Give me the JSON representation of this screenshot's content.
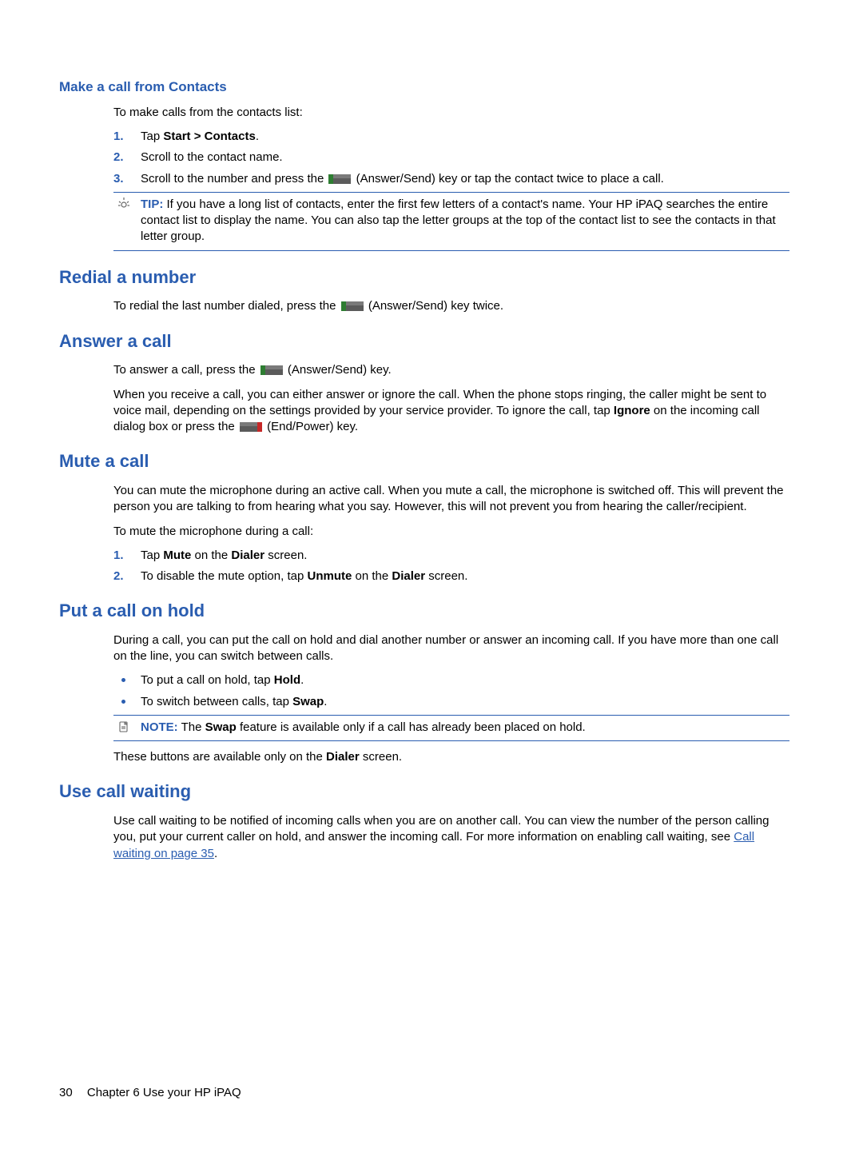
{
  "sec_contacts": {
    "title": "Make a call from Contacts",
    "intro": "To make calls from the contacts list:",
    "step1_a": "Tap ",
    "step1_b": "Start > Contacts",
    "step1_c": ".",
    "step2": "Scroll to the contact name.",
    "step3_a": "Scroll to the number and press the ",
    "step3_b": " (Answer/Send) key or tap the contact twice to place a call.",
    "tip_label": "TIP:",
    "tip_text": "If you have a long list of contacts, enter the first few letters of a contact's name. Your HP iPAQ searches the entire contact list to display the name. You can also tap the letter groups at the top of the contact list to see the contacts in that letter group."
  },
  "sec_redial": {
    "title": "Redial a number",
    "text_a": "To redial the last number dialed, press the ",
    "text_b": " (Answer/Send) key twice."
  },
  "sec_answer": {
    "title": "Answer a call",
    "p1_a": "To answer a call, press the ",
    "p1_b": " (Answer/Send) key.",
    "p2_a": "When you receive a call, you can either answer or ignore the call. When the phone stops ringing, the caller might be sent to voice mail, depending on the settings provided by your service provider. To ignore the call, tap ",
    "p2_b": "Ignore",
    "p2_c": " on the incoming call dialog box or press the ",
    "p2_d": " (End/Power) key."
  },
  "sec_mute": {
    "title": "Mute a call",
    "p1": "You can mute the microphone during an active call. When you mute a call, the microphone is switched off. This will prevent the person you are talking to from hearing what you say. However, this will not prevent you from hearing the caller/recipient.",
    "p2": "To mute the microphone during a call:",
    "s1_a": "Tap ",
    "s1_b": "Mute",
    "s1_c": " on the ",
    "s1_d": "Dialer",
    "s1_e": " screen.",
    "s2_a": "To disable the mute option, tap ",
    "s2_b": "Unmute",
    "s2_c": " on the ",
    "s2_d": "Dialer",
    "s2_e": " screen."
  },
  "sec_hold": {
    "title": "Put a call on hold",
    "p1": "During a call, you can put the call on hold and dial another number or answer an incoming call. If you have more than one call on the line, you can switch between calls.",
    "b1_a": "To put a call on hold, tap ",
    "b1_b": "Hold",
    "b1_c": ".",
    "b2_a": "To switch between calls, tap ",
    "b2_b": "Swap",
    "b2_c": ".",
    "note_label": "NOTE:",
    "note_a": "The ",
    "note_b": "Swap",
    "note_c": " feature is available only if a call has already been placed on hold.",
    "p3_a": "These buttons are available only on the ",
    "p3_b": "Dialer",
    "p3_c": " screen."
  },
  "sec_waiting": {
    "title": "Use call waiting",
    "p1_a": "Use call waiting to be notified of incoming calls when you are on another call. You can view the number of the person calling you, put your current caller on hold, and answer the incoming call. For more information on enabling call waiting, see ",
    "link": "Call waiting on page 35",
    "p1_c": "."
  },
  "footer": {
    "page": "30",
    "chapter": "Chapter 6   Use your HP iPAQ"
  }
}
